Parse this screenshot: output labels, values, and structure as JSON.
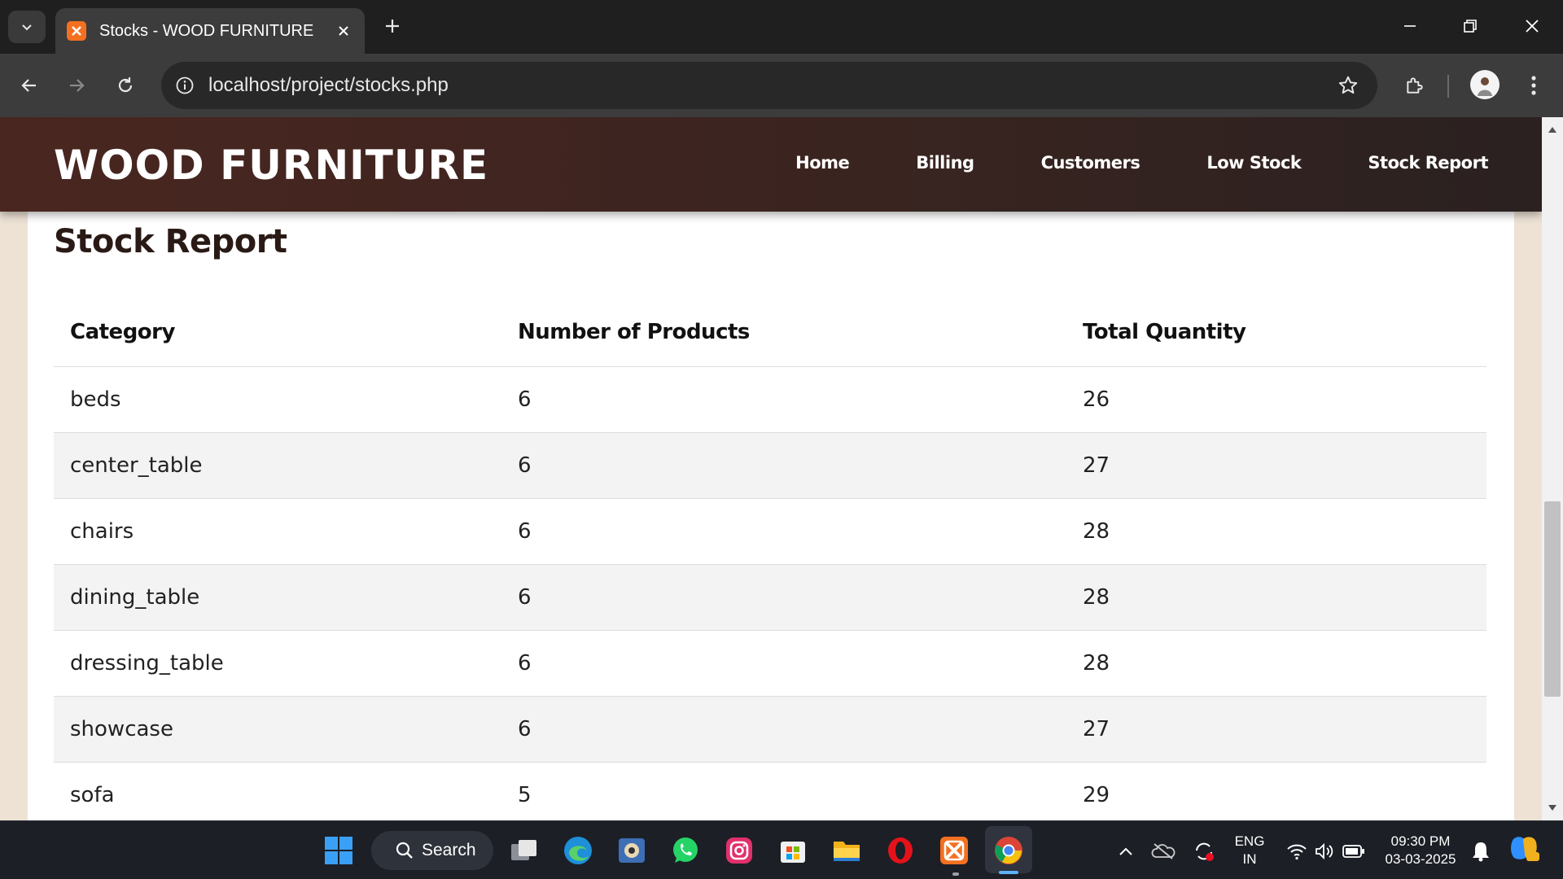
{
  "browser": {
    "tab_title": "Stocks - WOOD FURNITURE",
    "url": "localhost/project/stocks.php",
    "icons": [
      "tab-search-icon",
      "xampp-favicon-icon",
      "close-icon",
      "plus-icon",
      "minimize-icon",
      "restore-icon",
      "window-close-icon",
      "back-icon",
      "forward-icon",
      "reload-icon",
      "info-icon",
      "star-icon",
      "extensions-icon",
      "profile-avatar",
      "more-vert-icon"
    ]
  },
  "site": {
    "brand": "WOOD FURNITURE",
    "nav": [
      {
        "label": "Home"
      },
      {
        "label": "Billing"
      },
      {
        "label": "Customers"
      },
      {
        "label": "Low Stock"
      },
      {
        "label": "Stock Report"
      }
    ],
    "page_title": "Stock Report",
    "table": {
      "headers": [
        "Category",
        "Number of Products",
        "Total Quantity"
      ],
      "rows": [
        [
          "beds",
          "6",
          "26"
        ],
        [
          "center_table",
          "6",
          "27"
        ],
        [
          "chairs",
          "6",
          "28"
        ],
        [
          "dining_table",
          "6",
          "28"
        ],
        [
          "dressing_table",
          "6",
          "28"
        ],
        [
          "showcase",
          "6",
          "27"
        ],
        [
          "sofa",
          "5",
          "29"
        ]
      ]
    },
    "colors": {
      "header_bg": "#3a2420",
      "page_bg": "#ede2d4",
      "card_bg": "#ffffff",
      "alt_row": "#f3f3f3"
    }
  },
  "taskbar": {
    "search_label": "Search",
    "language_top": "ENG",
    "language_bottom": "IN",
    "time": "09:30 PM",
    "date": "03-03-2025",
    "apps": [
      "start-icon",
      "task-view-icon",
      "edge-icon",
      "photo-app-icon",
      "whatsapp-icon",
      "instagram-icon",
      "store-icon",
      "file-explorer-icon",
      "opera-icon",
      "xampp-icon",
      "chrome-icon"
    ],
    "tray_icons": [
      "chevron-up-icon",
      "onedrive-icon",
      "sync-icon",
      "wifi-icon",
      "volume-icon",
      "battery-icon",
      "bell-icon",
      "copilot-icon"
    ]
  }
}
